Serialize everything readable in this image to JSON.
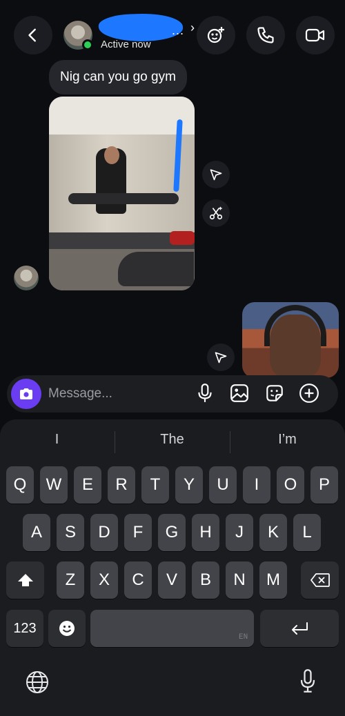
{
  "header": {
    "status": "Active now",
    "name_overflow": "..."
  },
  "messages": {
    "text_message": "Nig can you go gym"
  },
  "composer": {
    "placeholder": "Message..."
  },
  "keyboard": {
    "suggestions": [
      "I",
      "The",
      "I’m"
    ],
    "row1": [
      "Q",
      "W",
      "E",
      "R",
      "T",
      "Y",
      "U",
      "I",
      "O",
      "P"
    ],
    "row2": [
      "A",
      "S",
      "D",
      "F",
      "G",
      "H",
      "J",
      "K",
      "L"
    ],
    "row3": [
      "Z",
      "X",
      "C",
      "V",
      "B",
      "N",
      "M"
    ],
    "numbers_key": "123",
    "language": "EN"
  },
  "colors": {
    "background": "#0c0d10",
    "accent_camera": "#6a3df2",
    "online": "#2fcf57",
    "key": "#434449"
  },
  "icons": [
    "back-icon",
    "effects-icon",
    "phone-icon",
    "video-icon",
    "share-icon",
    "remix-icon",
    "camera-icon",
    "microphone-icon",
    "gallery-icon",
    "sticker-icon",
    "plus-icon",
    "shift-icon",
    "backspace-icon",
    "emoji-icon",
    "return-icon",
    "globe-icon",
    "dictation-icon"
  ]
}
